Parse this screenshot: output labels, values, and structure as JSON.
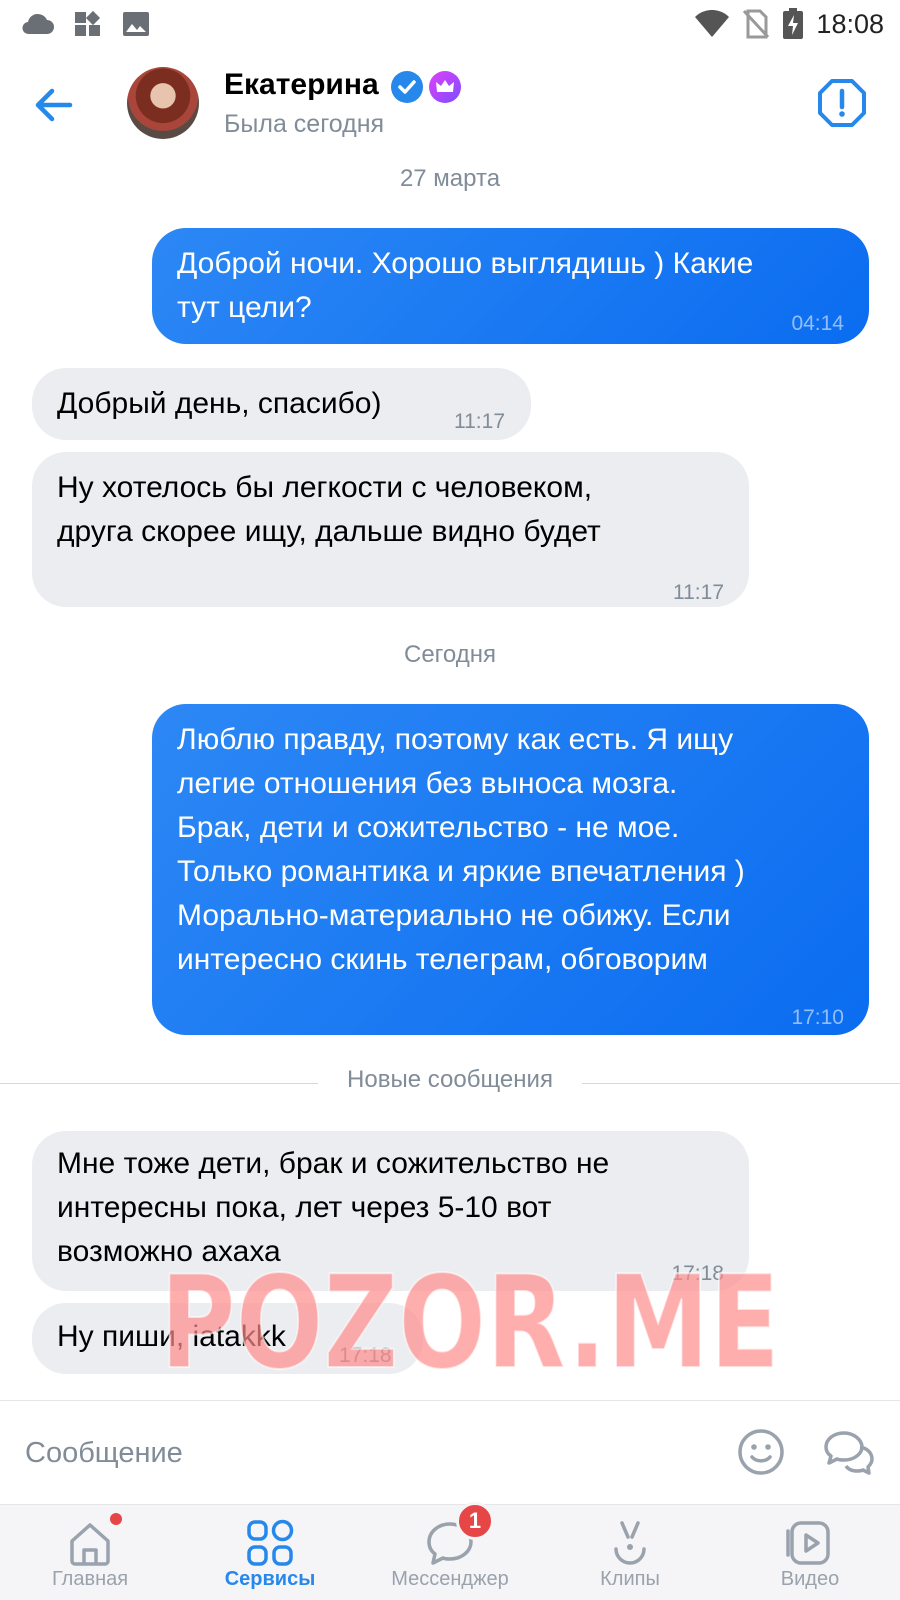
{
  "status_bar": {
    "time": "18:08",
    "left_icons": [
      "cloud-icon",
      "apps-icon",
      "image-icon"
    ],
    "right_icons": [
      "wifi-icon",
      "no-sim-icon",
      "battery-charging-icon"
    ]
  },
  "header": {
    "contact_name": "Екатерина",
    "contact_status": "Была сегодня",
    "icons": [
      "back-arrow-icon",
      "verified-icon",
      "crown-icon",
      "alert-icon"
    ]
  },
  "chat": {
    "date_1": "27 марта",
    "date_2": "Сегодня",
    "new_messages_label": "Новые сообщения",
    "messages": [
      {
        "direction": "out",
        "text": "Доброй ночи. Хорошо выглядишь ) Какие\nтут цели?",
        "time": "04:14"
      },
      {
        "direction": "in",
        "text": "Добрый день, спасибо)",
        "time": "11:17"
      },
      {
        "direction": "in",
        "text": "Ну хотелось бы легкости с человеком,\nдруга скорее ищу, дальше видно будет",
        "time": "11:17"
      },
      {
        "direction": "out",
        "text": "Люблю правду, поэтому как есть. Я ищу\nлегие отношения без выноса мозга.\nБрак, дети и сожительство - не мое.\nТолько романтика и яркие впечатления )\nМорально-материально не обижу. Если\nинтересно скинь телеграм, обговорим",
        "time": "17:10"
      },
      {
        "direction": "in",
        "text": "Мне тоже дети, брак и сожительство не\nинтересны пока, лет через 5-10 вот\nвозможно ахаха",
        "time": "17:18"
      },
      {
        "direction": "in",
        "text": "Ну пиши, iatakkk",
        "time": "17:18"
      }
    ]
  },
  "watermark": {
    "text": "POZOR.ME",
    "color": "#ff8c8c"
  },
  "composer": {
    "placeholder": "Сообщение",
    "icons": [
      "emoji-icon",
      "voice-message-icon"
    ]
  },
  "tabbar": {
    "tabs": [
      {
        "label": "Главная",
        "icon": "home-icon",
        "active": false,
        "dot": true
      },
      {
        "label": "Сервисы",
        "icon": "services-icon",
        "active": true
      },
      {
        "label": "Мессенджер",
        "icon": "messenger-icon",
        "active": false,
        "badge": "1"
      },
      {
        "label": "Клипы",
        "icon": "clips-icon",
        "active": false
      },
      {
        "label": "Видео",
        "icon": "video-icon",
        "active": false
      }
    ]
  },
  "colors": {
    "accent": "#2688eb",
    "outgoing_bubble": "#0a6cf0",
    "incoming_bubble": "#ebedf0",
    "secondary_text": "#818c99",
    "badge": "#e64646",
    "crown_gradient": [
      "#e040fb",
      "#7c4dff"
    ]
  }
}
